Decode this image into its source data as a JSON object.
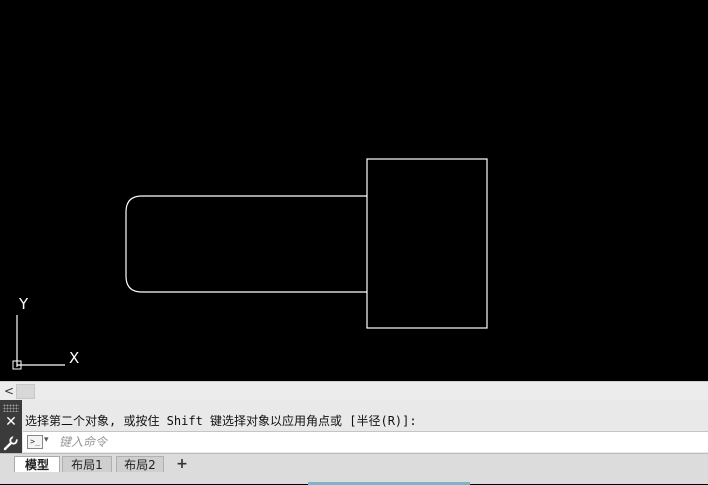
{
  "canvas": {
    "background": "#000000",
    "stroke": "#ffffff",
    "axis_y_label": "Y",
    "axis_x_label": "X"
  },
  "scrollbar": {
    "left_arrow": "<"
  },
  "command": {
    "close_glyph": "✕",
    "history_line": "选择第二个对象, 或按住 Shift 键选择对象以应用角点或 [半径(R)]:",
    "prompt_icon": ">_",
    "dropdown_glyph": "▾",
    "input_value": "",
    "input_placeholder": "键入命令"
  },
  "tabs": [
    {
      "label": "模型",
      "active": true
    },
    {
      "label": "布局1",
      "active": false
    },
    {
      "label": "布局2",
      "active": false
    }
  ],
  "tab_add_label": "+"
}
